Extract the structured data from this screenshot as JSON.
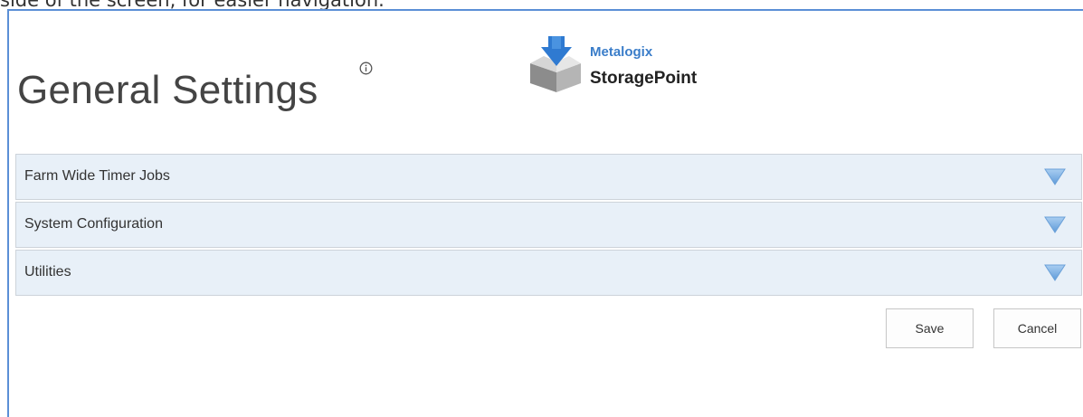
{
  "top_text": "side of the screen, for easier navigation.",
  "page": {
    "title": "General Settings"
  },
  "icons": {
    "info": "info-circle-icon",
    "logo": "storage-box-arrow-icon",
    "expand": "triangle-down-icon"
  },
  "logo": {
    "brand": "Metalogix",
    "product": "StoragePoint"
  },
  "sections": [
    {
      "label": "Farm Wide Timer Jobs"
    },
    {
      "label": "System Configuration"
    },
    {
      "label": "Utilities"
    }
  ],
  "buttons": {
    "save": "Save",
    "cancel": "Cancel"
  },
  "colors": {
    "frame": "#5b8fd6",
    "section_bg": "#e8f0f8",
    "toggle": "#7fb0e3",
    "brand": "#3a7dc9"
  }
}
